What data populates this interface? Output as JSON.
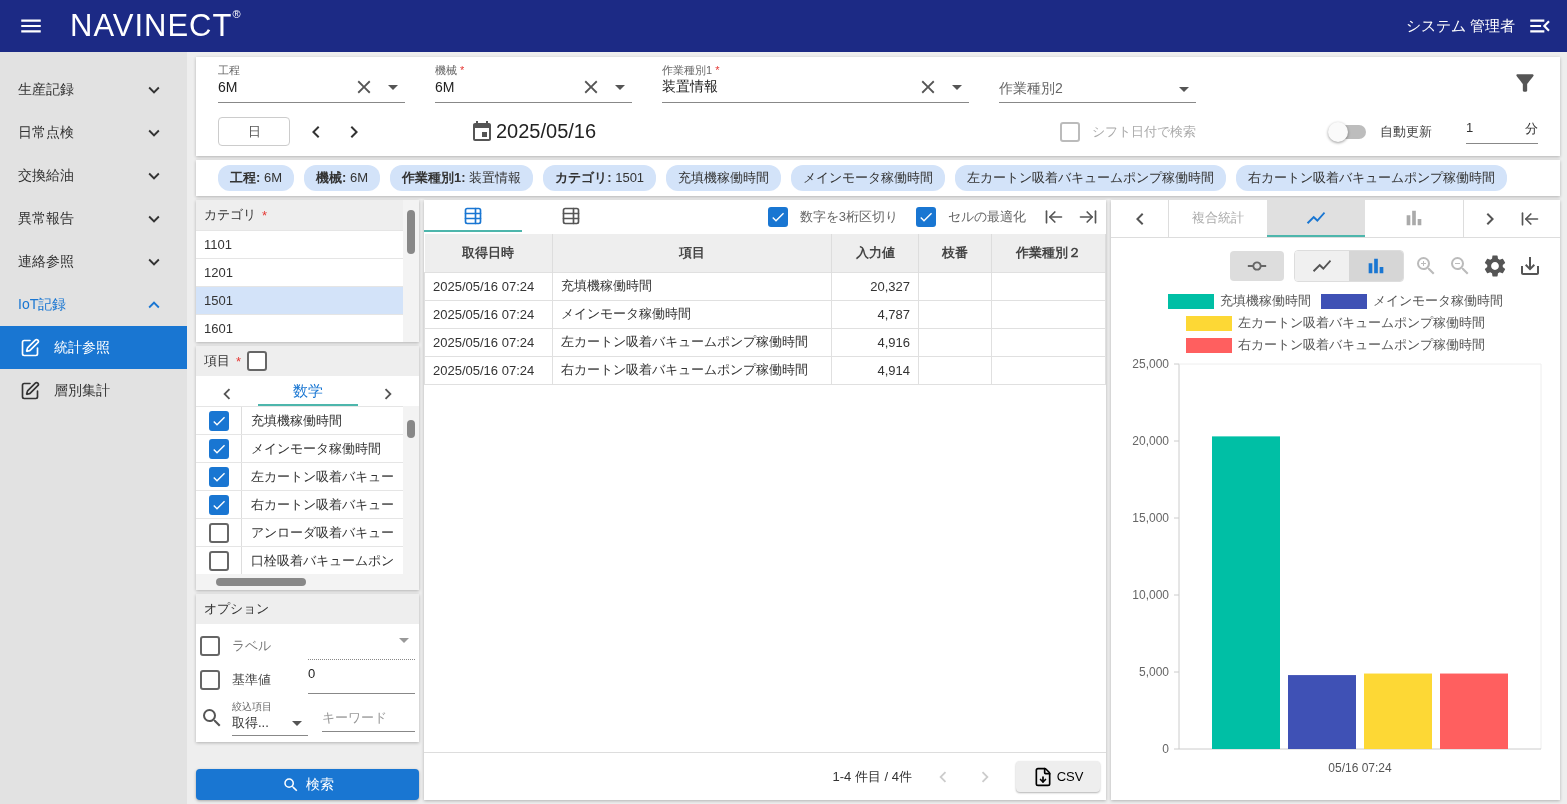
{
  "header": {
    "logo": "NAVINECT$^{®}$",
    "user": "システム 管理者"
  },
  "sidebar": {
    "items": [
      {
        "label": "生産記録",
        "expanded": false
      },
      {
        "label": "日常点検",
        "expanded": false
      },
      {
        "label": "交換給油",
        "expanded": false
      },
      {
        "label": "異常報告",
        "expanded": false
      },
      {
        "label": "連絡参照",
        "expanded": false
      },
      {
        "label": "IoT記録",
        "expanded": true,
        "children": [
          {
            "label": "統計参照",
            "selected": true
          },
          {
            "label": "層別集計",
            "selected": false
          }
        ]
      }
    ]
  },
  "filters": {
    "fields": [
      {
        "label": "工程",
        "value": "6M",
        "clearable": true
      },
      {
        "label": "機械",
        "required_mark": "*",
        "value": "6M",
        "clearable": true
      },
      {
        "label": "作業種別1",
        "required_mark": "*",
        "value": "装置情報",
        "clearable": true
      },
      {
        "label": "作業種別2",
        "clearable": false
      }
    ],
    "period_unit": "日",
    "date": "2025/05/16",
    "shift_search": {
      "label": "シフト日付で検索",
      "checked": false,
      "disabled": true
    },
    "auto_refresh": {
      "label": "自動更新",
      "on": false,
      "interval": "1",
      "unit": "分"
    }
  },
  "chips": [
    "**工程:** 6M",
    "**機械:** 6M",
    "**作業種別1:** 装置情報",
    "**カテゴリ:** 1501",
    "充填機稼働時間",
    "メインモータ稼働時間",
    "左カートン吸着バキュームポンプ稼働時間",
    "右カートン吸着バキュームポンプ稼働時間"
  ],
  "category": {
    "title": "カテゴリ",
    "required_mark": "*",
    "rows": [
      {
        "label": "1101",
        "selected": false
      },
      {
        "label": "1201",
        "selected": false
      },
      {
        "label": "1501",
        "selected": true
      },
      {
        "label": "1601",
        "selected": false
      }
    ]
  },
  "items": {
    "title": "項目",
    "required_mark": "*",
    "all_checked": false,
    "tab": "数学",
    "rows": [
      {
        "label": "充填機稼働時間",
        "checked": true
      },
      {
        "label": "メインモータ稼働時間",
        "checked": true
      },
      {
        "label": "左カートン吸着バキュー",
        "checked": true
      },
      {
        "label": "右カートン吸着バキュー",
        "checked": true
      },
      {
        "label": "アンローダ吸着バキュー",
        "checked": false
      },
      {
        "label": "口栓吸着バキュームポン",
        "checked": false
      }
    ]
  },
  "options": {
    "title": "オプション",
    "label_option": {
      "label": "ラベル",
      "checked": false
    },
    "baseline": {
      "label": "基準値",
      "checked": false,
      "value": "0"
    },
    "filter": {
      "label": "絞込項目",
      "value": "取得...",
      "keyword_placeholder": "キーワード"
    }
  },
  "search_button": "検索",
  "table": {
    "view_tabs": [
      {
        "selected": true
      },
      {
        "selected": false
      }
    ],
    "options": [
      {
        "label": "数字を3桁区切り",
        "checked": true
      },
      {
        "label": "セルの最適化",
        "checked": true
      }
    ],
    "columns": [
      "取得日時",
      "項目",
      "入力値",
      "枝番",
      "作業種別２"
    ],
    "rows": [
      [
        "2025/05/16 07:24",
        "充填機稼働時間",
        "20,327",
        "",
        ""
      ],
      [
        "2025/05/16 07:24",
        "メインモータ稼働時間",
        "4,787",
        "",
        ""
      ],
      [
        "2025/05/16 07:24",
        "左カートン吸着バキュームポンプ稼働時間",
        "4,916",
        "",
        ""
      ],
      [
        "2025/05/16 07:24",
        "右カートン吸着バキュームポンプ稼働時間",
        "4,914",
        "",
        ""
      ]
    ],
    "pagination": "1-4 件目 / 4件",
    "csv": "CSV"
  },
  "chart_panel": {
    "tabs": [
      {
        "kind": "text",
        "label": "複合統計",
        "selected": false
      },
      {
        "kind": "line",
        "selected": true
      },
      {
        "kind": "bar",
        "selected": false
      }
    ],
    "marker_toggle": {
      "on": false
    },
    "modes": [
      {
        "kind": "line",
        "selected": false
      },
      {
        "kind": "bar",
        "selected": true
      }
    ],
    "chart_data": {
      "type": "bar",
      "categories": [
        "05/16 07:24"
      ],
      "series": [
        {
          "name": "充填機稼働時間",
          "color": "#00bfa5",
          "values": [
            20300
          ]
        },
        {
          "name": "メインモータ稼働時間",
          "color": "#3f51b5",
          "values": [
            4800
          ]
        },
        {
          "name": "左カートン吸着バキュームポンプ稼働時間",
          "color": "#fdd835",
          "values": [
            4900
          ]
        },
        {
          "name": "右カートン吸着バキュームポンプ稼働時間",
          "color": "#ff5f5f",
          "values": [
            4900
          ]
        }
      ],
      "ylim": [
        0,
        25000
      ],
      "yticks": [
        {
          "value": 0,
          "label": "0"
        },
        {
          "value": 5000,
          "label": "5,000"
        },
        {
          "value": 10000,
          "label": "10,000"
        },
        {
          "value": 15000,
          "label": "15,000"
        },
        {
          "value": 20000,
          "label": "20,000"
        },
        {
          "value": 25000,
          "label": "25,000"
        }
      ]
    }
  }
}
